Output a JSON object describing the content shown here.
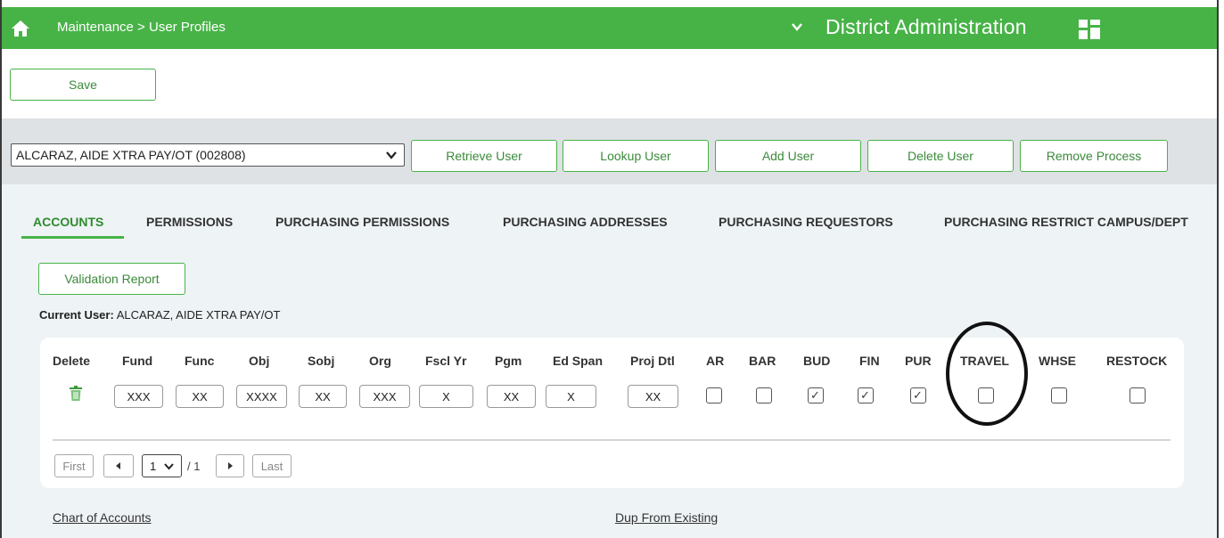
{
  "header": {
    "breadcrumb": "Maintenance > User Profiles",
    "district": "District Administration",
    "accent_color": "#47b347"
  },
  "toolbar": {
    "save_label": "Save"
  },
  "user_bar": {
    "selected_user": "ALCARAZ, AIDE XTRA PAY/OT (002808)",
    "retrieve_label": "Retrieve User",
    "lookup_label": "Lookup User",
    "add_label": "Add User",
    "delete_label": "Delete User",
    "remove_process_label": "Remove Process"
  },
  "tabs": [
    {
      "label": "ACCOUNTS",
      "active": true
    },
    {
      "label": "PERMISSIONS"
    },
    {
      "label": "PURCHASING PERMISSIONS"
    },
    {
      "label": "PURCHASING ADDRESSES"
    },
    {
      "label": "PURCHASING REQUESTORS"
    },
    {
      "label": "PURCHASING RESTRICT CAMPUS/DEPT"
    }
  ],
  "validation_report_label": "Validation Report",
  "current_user": {
    "label": "Current User:",
    "value": "ALCARAZ, AIDE XTRA PAY/OT"
  },
  "table": {
    "columns": [
      "Delete",
      "Fund",
      "Func",
      "Obj",
      "Sobj",
      "Org",
      "Fscl Yr",
      "Pgm",
      "Ed Span",
      "Proj Dtl",
      "AR",
      "BAR",
      "BUD",
      "FIN",
      "PUR",
      "TRAVEL",
      "WHSE",
      "RESTOCK"
    ],
    "row": {
      "fund": "XXX",
      "func": "XX",
      "obj": "XXXX",
      "sobj": "XX",
      "org": "XXX",
      "fscl_yr": "X",
      "pgm": "XX",
      "ed_span": "X",
      "proj_dtl": "XX",
      "ar": false,
      "bar": false,
      "bud": true,
      "fin": true,
      "pur": true,
      "travel": false,
      "whse": false,
      "restock": false
    }
  },
  "pagination": {
    "first": "First",
    "page": "1",
    "of": "/ 1",
    "last": "Last"
  },
  "links": {
    "chart_of_accounts": "Chart of Accounts",
    "dup_from_existing": "Dup From Existing"
  }
}
